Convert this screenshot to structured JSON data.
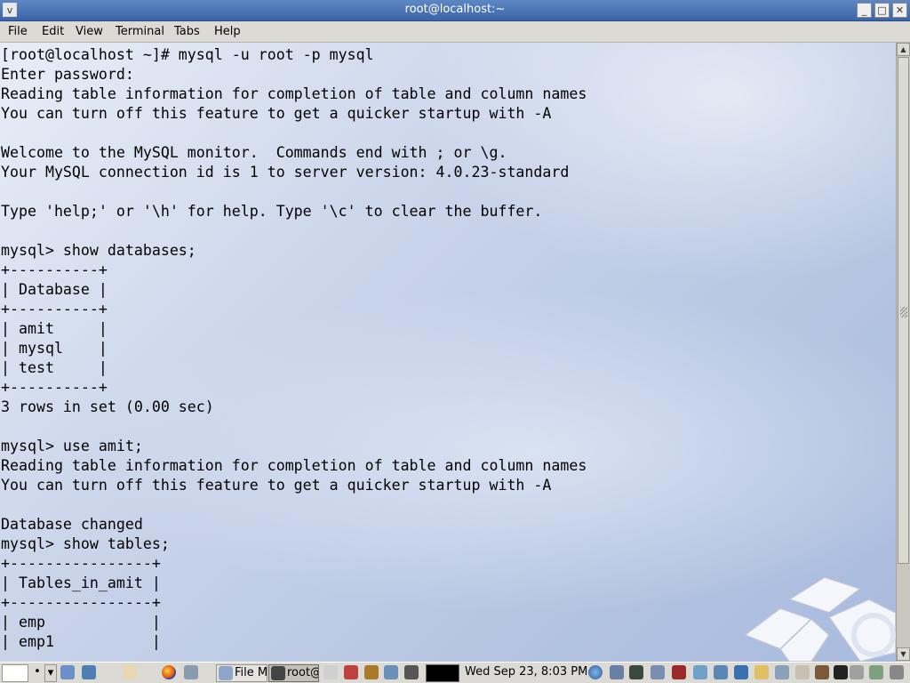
{
  "window": {
    "title": "root@localhost:~",
    "menu_glyph": "v",
    "minimize": "_",
    "maximize": "□",
    "close": "✕"
  },
  "menubar": {
    "items": [
      "File",
      "Edit",
      "View",
      "Terminal",
      "Tabs",
      "Help"
    ]
  },
  "terminal": {
    "lines": [
      "[root@localhost ~]# mysql -u root -p mysql",
      "Enter password:",
      "Reading table information for completion of table and column names",
      "You can turn off this feature to get a quicker startup with -A",
      "",
      "Welcome to the MySQL monitor.  Commands end with ; or \\g.",
      "Your MySQL connection id is 1 to server version: 4.0.23-standard",
      "",
      "Type 'help;' or '\\h' for help. Type '\\c' to clear the buffer.",
      "",
      "mysql> show databases;",
      "+----------+",
      "| Database |",
      "+----------+",
      "| amit     |",
      "| mysql    |",
      "| test     |",
      "+----------+",
      "3 rows in set (0.00 sec)",
      "",
      "mysql> use amit;",
      "Reading table information for completion of table and column names",
      "You can turn off this feature to get a quicker startup with -A",
      "",
      "Database changed",
      "mysql> show tables;",
      "+----------------+",
      "| Tables_in_amit |",
      "+----------------+",
      "| emp            |",
      "| emp1           |"
    ]
  },
  "scrollbar": {
    "up": "▲",
    "down": "▼"
  },
  "taskbar": {
    "workspace_glyph": "•",
    "dropdown_glyph": "▾",
    "tasks": [
      {
        "label": "File M",
        "icon": "file-manager-icon"
      },
      {
        "label": "root@",
        "icon": "terminal-icon",
        "active": true
      }
    ],
    "clock": "Wed Sep 23,  8:03 PM",
    "colors": {
      "title_bar": "#3a64a8",
      "panel": "#dcdad5"
    }
  }
}
